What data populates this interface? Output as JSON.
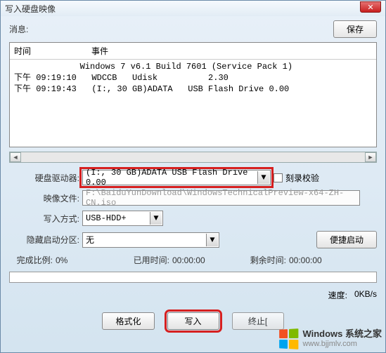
{
  "window": {
    "title": "写入硬盘映像"
  },
  "toolbar": {
    "message_label": "消息:",
    "save_label": "保存"
  },
  "log": {
    "header_time": "时间",
    "header_event": "事件",
    "lines": "             Windows 7 v6.1 Build 7601 (Service Pack 1)\n下午 09:19:10   WDCCB   Udisk          2.30\n下午 09:19:43   (I:, 30 GB)ADATA   USB Flash Drive 0.00"
  },
  "form": {
    "drive_label": "硬盘驱动器:",
    "drive_value": "(I:, 30 GB)ADATA   USB Flash Drive 0.00",
    "verify_label": "刻录校验",
    "image_label": "映像文件:",
    "image_value": "F:\\BaiduYunDownload\\WindowsTechnicalPreview-x64-ZH-CN.iso",
    "method_label": "写入方式:",
    "method_value": "USB-HDD+",
    "hidden_label": "隐藏启动分区:",
    "hidden_value": "无",
    "convenient_boot": "便捷启动"
  },
  "stats": {
    "percent_label": "完成比例:",
    "percent_value": "0%",
    "elapsed_label": "已用时间:",
    "elapsed_value": "00:00:00",
    "remaining_label": "剩余时间:",
    "remaining_value": "00:00:00",
    "speed_label": "速度:",
    "speed_value": "0KB/s"
  },
  "buttons": {
    "format": "格式化",
    "write": "写入",
    "abort": "终止["
  },
  "watermark": {
    "brand": "Windows 系统之家",
    "url": "www.bjjmlv.com"
  }
}
